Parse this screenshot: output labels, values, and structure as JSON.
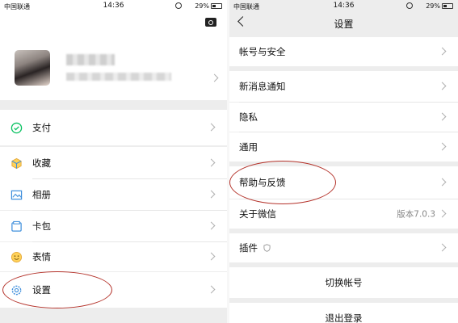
{
  "status_left": {
    "carrier": "中国联通",
    "time": "14:36",
    "battery": "29%"
  },
  "status_right": {
    "carrier": "中国联通",
    "time": "14:36",
    "battery": "29%"
  },
  "me": {
    "items": [
      {
        "label": "支付",
        "icon": "payment-icon"
      },
      {
        "label": "收藏",
        "icon": "favorites-icon"
      },
      {
        "label": "相册",
        "icon": "album-icon"
      },
      {
        "label": "卡包",
        "icon": "card-icon"
      },
      {
        "label": "表情",
        "icon": "sticker-icon"
      },
      {
        "label": "设置",
        "icon": "settings-icon"
      }
    ]
  },
  "settings": {
    "title": "设置",
    "account_security": "帐号与安全",
    "notifications": "新消息通知",
    "privacy": "隐私",
    "general": "通用",
    "help_feedback": "帮助与反馈",
    "about": "关于微信",
    "version": "版本7.0.3",
    "plugins": "插件",
    "switch_account": "切换帐号",
    "logout": "退出登录"
  },
  "colors": {
    "accent_green": "#07c160",
    "annotation_red": "#b4322a"
  }
}
